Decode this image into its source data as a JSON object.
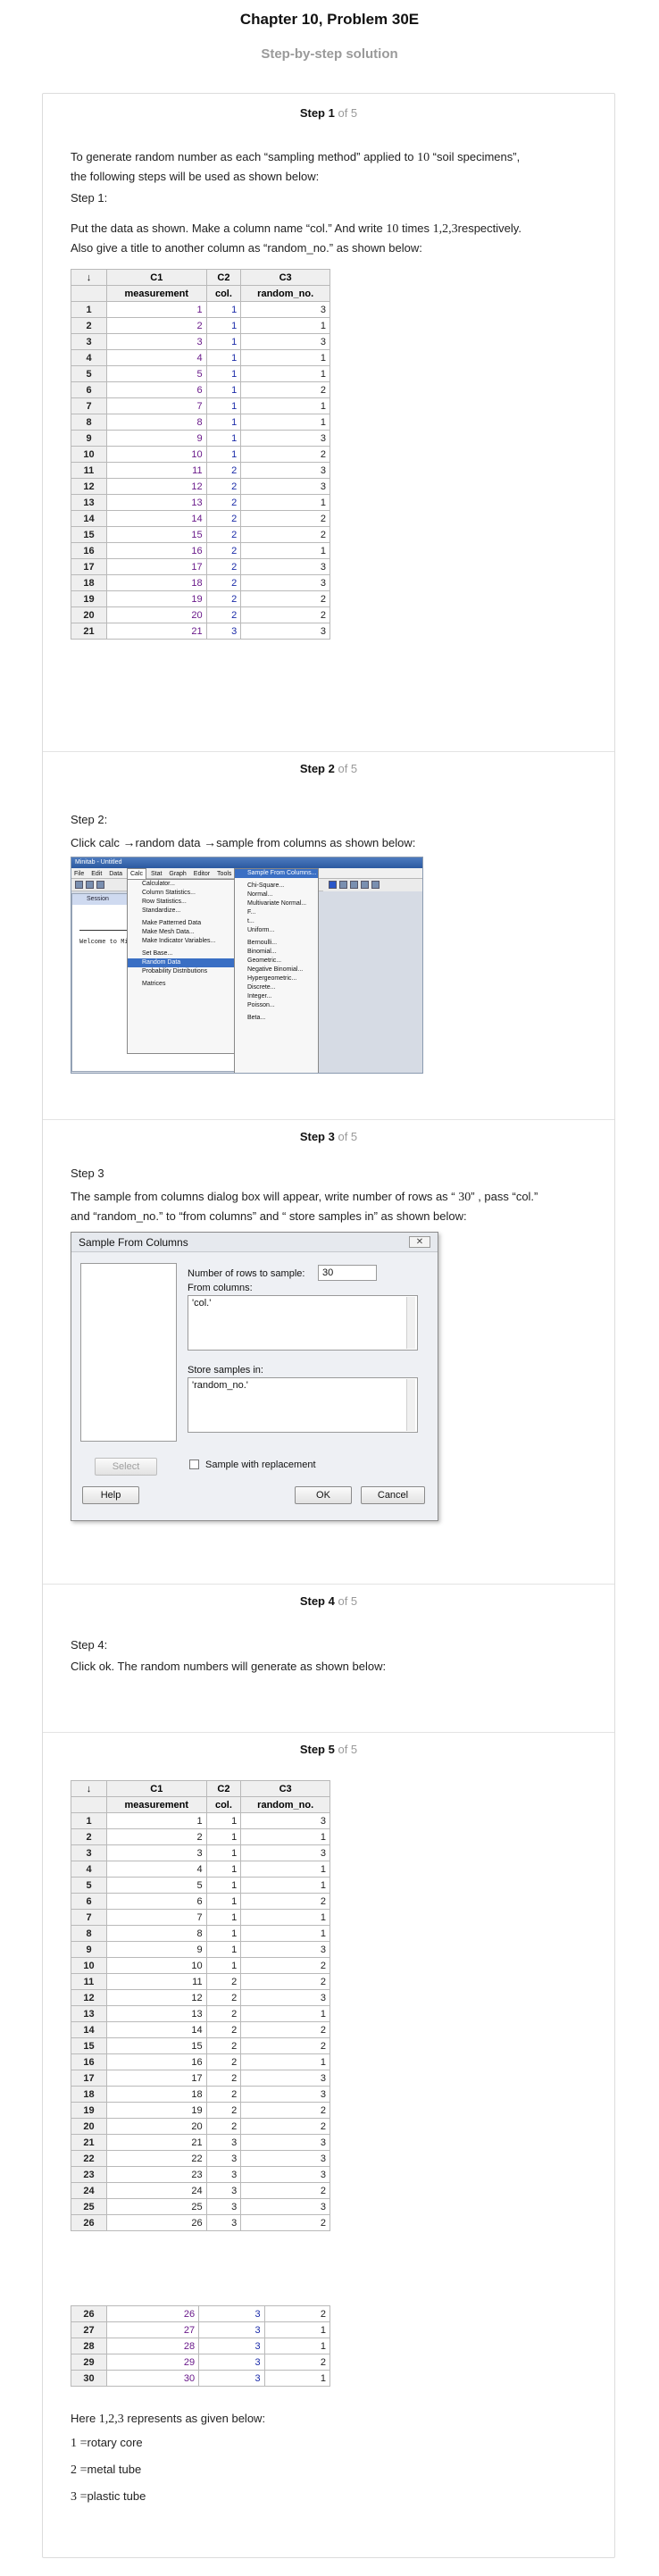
{
  "header": {
    "title": "Chapter 10, Problem 30E",
    "subtitle": "Step-by-step solution"
  },
  "steps": [
    {
      "label": "Step 1",
      "of": "of 5"
    },
    {
      "label": "Step 2",
      "of": "of 5"
    },
    {
      "label": "Step 3",
      "of": "of 5"
    },
    {
      "label": "Step 4",
      "of": "of 5"
    },
    {
      "label": "Step 5",
      "of": "of 5"
    }
  ],
  "step1": {
    "p1a": "To generate random number as each “sampling method” applied to ",
    "p1_num": "10",
    "p1b": " “soil specimens”,",
    "p2": "the following steps will be used as shown below:",
    "heading": "Step 1:",
    "p3a": "Put the data as shown. Make a column name “col.” And write ",
    "p3_num": "10",
    "p3b": " times ",
    "p3_seq": "1,2,3",
    "p3c": "respectively.",
    "p4": "Also give a title to another column as “random_no.” as shown below:"
  },
  "worksheet1": {
    "corner": "↓",
    "cols": [
      "C1",
      "C2",
      "C3"
    ],
    "names": [
      "measurement",
      "col.",
      "random_no."
    ],
    "rows": [
      [
        "1",
        "1",
        "1",
        "3"
      ],
      [
        "2",
        "2",
        "1",
        "1"
      ],
      [
        "3",
        "3",
        "1",
        "3"
      ],
      [
        "4",
        "4",
        "1",
        "1"
      ],
      [
        "5",
        "5",
        "1",
        "1"
      ],
      [
        "6",
        "6",
        "1",
        "2"
      ],
      [
        "7",
        "7",
        "1",
        "1"
      ],
      [
        "8",
        "8",
        "1",
        "1"
      ],
      [
        "9",
        "9",
        "1",
        "3"
      ],
      [
        "10",
        "10",
        "1",
        "2"
      ],
      [
        "11",
        "11",
        "2",
        "3"
      ],
      [
        "12",
        "12",
        "2",
        "3"
      ],
      [
        "13",
        "13",
        "2",
        "1"
      ],
      [
        "14",
        "14",
        "2",
        "2"
      ],
      [
        "15",
        "15",
        "2",
        "2"
      ],
      [
        "16",
        "16",
        "2",
        "1"
      ],
      [
        "17",
        "17",
        "2",
        "3"
      ],
      [
        "18",
        "18",
        "2",
        "3"
      ],
      [
        "19",
        "19",
        "2",
        "2"
      ],
      [
        "20",
        "20",
        "2",
        "2"
      ],
      [
        "21",
        "21",
        "3",
        "3"
      ]
    ]
  },
  "step2": {
    "heading": "Step 2:",
    "p1a": "Click calc ",
    "arrow": "→",
    "p1b": "random data ",
    "p1c": "sample from columns as shown below:"
  },
  "minitab": {
    "title": "Minitab - Untitled",
    "menus": [
      "File",
      "Edit",
      "Data",
      "Calc",
      "Stat",
      "Graph",
      "Editor",
      "Tools"
    ],
    "session": "Session",
    "welcome": "Welcome to Mi",
    "calc_items": [
      "Calculator...",
      "Column Statistics...",
      "Row Statistics...",
      "Standardize...",
      "",
      "Make Patterned Data",
      "Make Mesh Data...",
      "Make Indicator Variables...",
      "",
      "Set Base...",
      "Random Data",
      "Probability Distributions",
      "",
      "Matrices"
    ],
    "random_items": [
      "Sample From Columns...",
      "",
      "Chi-Square...",
      "Normal...",
      "Multivariate Normal...",
      "F...",
      "t...",
      "Uniform...",
      "",
      "Bernoulli...",
      "Binomial...",
      "Geometric...",
      "Negative Binomial...",
      "Hypergeometric...",
      "Discrete...",
      "Integer...",
      "Poisson...",
      "",
      "Beta..."
    ]
  },
  "step3": {
    "heading": "Step 3",
    "p1a": "The sample from columns dialog box will appear, write number of rows as “ ",
    "p1_num": "30",
    "p1b": "” , pass “col.”",
    "p2": "and “random_no.” to “from columns” and “ store samples in” as shown below:"
  },
  "dialog": {
    "title": "Sample From Columns",
    "close": "✕",
    "rows_label": "Number of rows to sample:",
    "rows_value": "30",
    "from_label": "From columns:",
    "from_value": "'col.'",
    "store_label": "Store samples in:",
    "store_value": "'random_no.'",
    "replacement_label": "Sample with replacement",
    "select": "Select",
    "help": "Help",
    "ok": "OK",
    "cancel": "Cancel"
  },
  "step4": {
    "heading": "Step 4:",
    "p1": "Click ok. The random numbers will generate as shown below:"
  },
  "worksheet2": {
    "corner": "↓",
    "cols": [
      "C1",
      "C2",
      "C3"
    ],
    "names": [
      "measurement",
      "col.",
      "random_no."
    ],
    "rows": [
      [
        "1",
        "1",
        "1",
        "3"
      ],
      [
        "2",
        "2",
        "1",
        "1"
      ],
      [
        "3",
        "3",
        "1",
        "3"
      ],
      [
        "4",
        "4",
        "1",
        "1"
      ],
      [
        "5",
        "5",
        "1",
        "1"
      ],
      [
        "6",
        "6",
        "1",
        "2"
      ],
      [
        "7",
        "7",
        "1",
        "1"
      ],
      [
        "8",
        "8",
        "1",
        "1"
      ],
      [
        "9",
        "9",
        "1",
        "3"
      ],
      [
        "10",
        "10",
        "1",
        "2"
      ],
      [
        "11",
        "11",
        "2",
        "2"
      ],
      [
        "12",
        "12",
        "2",
        "3"
      ],
      [
        "13",
        "13",
        "2",
        "1"
      ],
      [
        "14",
        "14",
        "2",
        "2"
      ],
      [
        "15",
        "15",
        "2",
        "2"
      ],
      [
        "16",
        "16",
        "2",
        "1"
      ],
      [
        "17",
        "17",
        "2",
        "3"
      ],
      [
        "18",
        "18",
        "2",
        "3"
      ],
      [
        "19",
        "19",
        "2",
        "2"
      ],
      [
        "20",
        "20",
        "2",
        "2"
      ],
      [
        "21",
        "21",
        "3",
        "3"
      ],
      [
        "22",
        "22",
        "3",
        "3"
      ],
      [
        "23",
        "23",
        "3",
        "3"
      ],
      [
        "24",
        "24",
        "3",
        "2"
      ],
      [
        "25",
        "25",
        "3",
        "3"
      ],
      [
        "26",
        "26",
        "3",
        "2"
      ]
    ],
    "rows_b": [
      [
        "26",
        "26",
        "3",
        "2"
      ],
      [
        "27",
        "27",
        "3",
        "1"
      ],
      [
        "28",
        "28",
        "3",
        "1"
      ],
      [
        "29",
        "29",
        "3",
        "2"
      ],
      [
        "30",
        "30",
        "3",
        "1"
      ]
    ]
  },
  "step5": {
    "here": "Here ",
    "seq": "1,2,3",
    "here_b": " represents as given below:",
    "legend": [
      {
        "num": "1",
        "eq": "=",
        "text": "rotary core"
      },
      {
        "num": "2",
        "eq": "=",
        "text": "metal tube"
      },
      {
        "num": "3",
        "eq": "=",
        "text": "plastic tube"
      }
    ]
  }
}
